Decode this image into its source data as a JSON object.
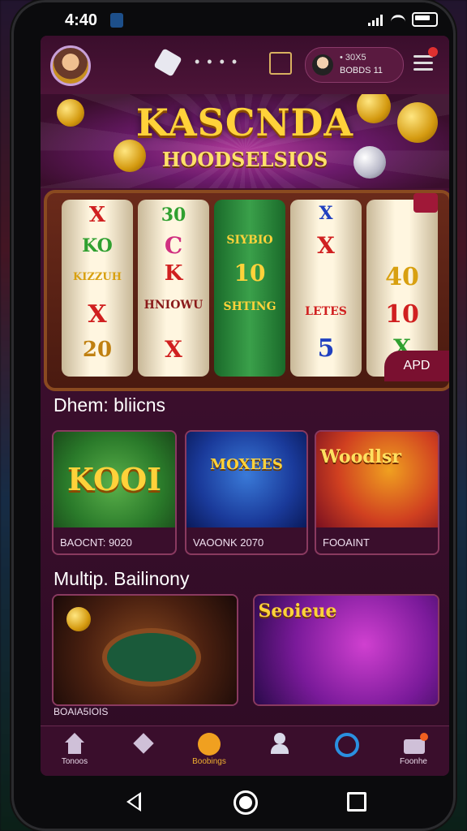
{
  "status_bar": {
    "time": "4:40"
  },
  "header": {
    "coins_line1": "• 30X5",
    "coins_line2": "BOBDS 11"
  },
  "hero": {
    "title": "KASCNDA",
    "subtitle": "HOODSELSIOS"
  },
  "slot": {
    "reels": [
      [
        "X",
        "KO",
        "KIZZUH",
        "X",
        "20"
      ],
      [
        "30",
        "C",
        "K",
        "HNIOWU",
        "X"
      ],
      [
        "",
        "SIYBIO",
        "10",
        "SHTING",
        ""
      ],
      [
        "X",
        "X",
        "",
        "LETES",
        "5"
      ],
      [
        "",
        "",
        "40",
        "10",
        "X"
      ]
    ],
    "apply_label": "APD"
  },
  "section1": {
    "title": "Dhem: bliicns",
    "cards": [
      {
        "art_text": "KOOI",
        "caption": "BAOCNT: 9020"
      },
      {
        "art_text": "MOXEES",
        "caption": "VAOONK 2070"
      },
      {
        "art_text": "Woodlsr",
        "caption": "FOOAINT"
      }
    ]
  },
  "section2": {
    "title": "Multip. Bailinony",
    "cards": [
      {
        "art_text": "",
        "caption": "BOAIA5IOIS"
      },
      {
        "art_text": "Seoieue",
        "caption": ""
      }
    ]
  },
  "bottom_nav": [
    {
      "label": "Tonoos",
      "icon": "home-icon"
    },
    {
      "label": "",
      "icon": "diamond-icon"
    },
    {
      "label": "Boobings",
      "icon": "coin-bag-icon"
    },
    {
      "label": "",
      "icon": "profile-icon"
    },
    {
      "label": "",
      "icon": "refresh-icon"
    },
    {
      "label": "Foonhe",
      "icon": "wallet-icon"
    }
  ],
  "colors": {
    "background": "#3c0f2e",
    "accent_gold": "#ffd23a",
    "card_border": "#8a3a60"
  }
}
